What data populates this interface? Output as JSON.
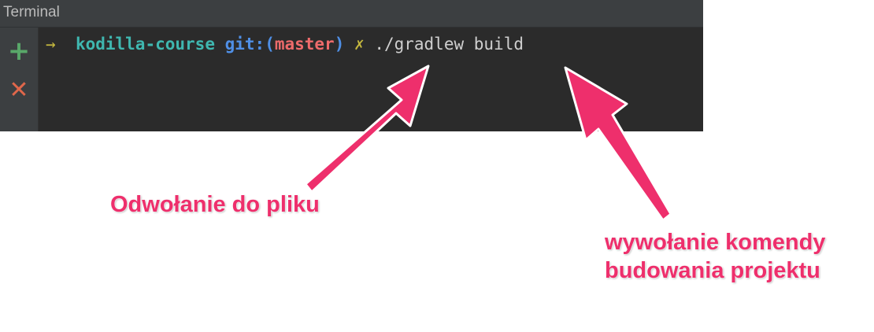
{
  "terminal": {
    "title": "Terminal",
    "side": {
      "add_icon": "+",
      "close_icon": "✕"
    },
    "prompt": {
      "arrow": "→",
      "directory": "kodilla-course",
      "git_label": "git:(",
      "branch": "master",
      "git_close": ")",
      "dirty_mark": "✗",
      "command": "./gradlew build"
    }
  },
  "annotations": {
    "file_reference": "Odwołanie do pliku",
    "command_call_line1": "wywołanie komendy",
    "command_call_line2": "budowania projektu",
    "color": "#ee2f6c"
  }
}
